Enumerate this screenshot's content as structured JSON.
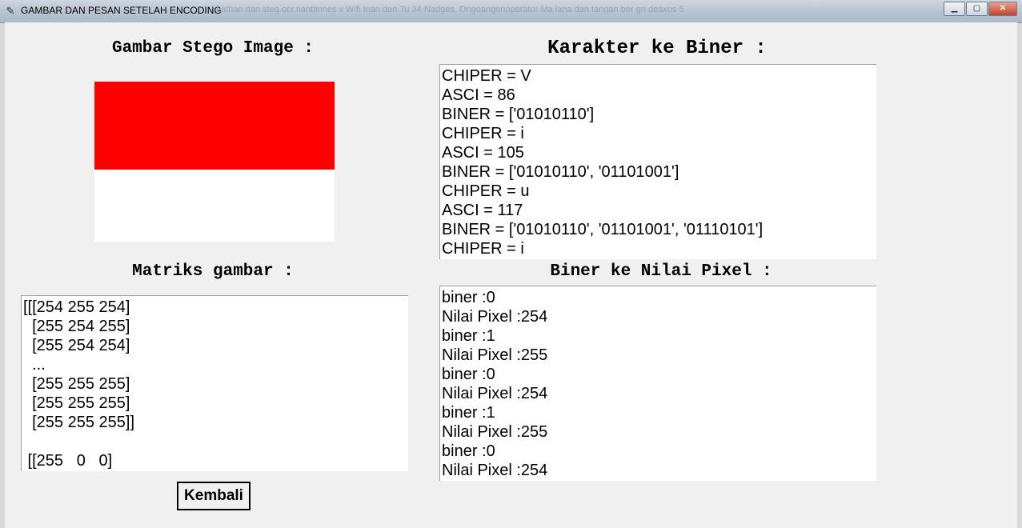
{
  "window": {
    "title": "GAMBAR DAN PESAN SETELAH ENCODING",
    "background_tabs": "Lathan dan steg.ocr.nanttinnes   x   Wifi Inan dan Tu 34 Nadges, Ongoangonoperator Ma lana  dan tangan ber gn deaxos 5",
    "controls": {
      "minimize": "▁",
      "maximize": "▢",
      "close": "✕"
    }
  },
  "stego": {
    "heading": "Gambar Stego Image :",
    "image_colors": {
      "top": "#ff0000",
      "bottom": "#ffffff"
    }
  },
  "karakter": {
    "heading": "Karakter ke Biner :",
    "lines": [
      "CHIPER = V",
      "ASCI = 86",
      "BINER = ['01010110']",
      "CHIPER = i",
      "ASCI = 105",
      "BINER = ['01010110', '01101001']",
      "CHIPER = u",
      "ASCI = 117",
      "BINER = ['01010110', '01101001', '01110101']",
      "CHIPER = i"
    ]
  },
  "matriks": {
    "heading": "Matriks gambar :",
    "lines": [
      "[[[254 255 254]",
      "  [255 254 255]",
      "  [255 254 254]",
      "  ...",
      "  [255 255 255]",
      "  [255 255 255]",
      "  [255 255 255]]",
      "",
      " [[255   0   0]"
    ]
  },
  "biner": {
    "heading": "Biner ke Nilai Pixel :",
    "lines": [
      "biner :0",
      "Nilai Pixel :254",
      "biner :1",
      "Nilai Pixel :255",
      "biner :0",
      "Nilai Pixel :254",
      "biner :1",
      "Nilai Pixel :255",
      "biner :0",
      "Nilai Pixel :254"
    ]
  },
  "buttons": {
    "kembali": "Kembali"
  }
}
